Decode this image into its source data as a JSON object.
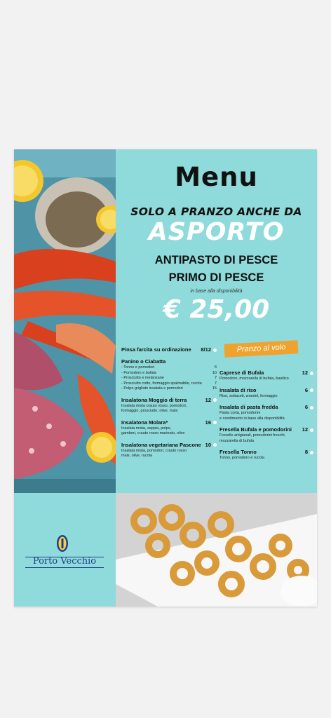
{
  "header": {
    "title": "Menu",
    "tagline": "SOLO A PRANZO ANCHE DA",
    "highlight": "ASPORTO"
  },
  "offer": {
    "line1": "ANTIPASTO DI PESCE",
    "line2": "PRIMO DI PESCE",
    "note": "in base alla disponibilità",
    "price": "€ 25,00"
  },
  "banner": "Pranzo al volo",
  "left_column": [
    {
      "name": "Pinsa farcita su ordinazione",
      "price": "8/12",
      "desc": []
    },
    {
      "name": "Panino o Ciabatta",
      "price": "",
      "desc": [
        {
          "text": "- Tonno e pomodori",
          "price": "6"
        },
        {
          "text": "- Pomodoro e bufala",
          "price": "10"
        },
        {
          "text": "- Prosciutto e melanzane",
          "price": "7"
        },
        {
          "text": "- Prosciutto cotto, formaggio spalmabile, rucola",
          "price": "7"
        },
        {
          "text": "- Polpo grigliato insalata e pomodori",
          "price": "15"
        }
      ]
    },
    {
      "name": "Insalatona Moggio di terra",
      "price": "12",
      "desc": [
        {
          "text": "Insalata mista crauto rosso, pomodori,",
          "price": ""
        },
        {
          "text": "formaggio, prosciutto, olive, mais",
          "price": ""
        }
      ]
    },
    {
      "name": "Insalatona Molara*",
      "price": "16",
      "desc": [
        {
          "text": "Insalata mista, seppia, polpo,",
          "price": ""
        },
        {
          "text": "gamberi, crauto rosso marinato, olive",
          "price": ""
        }
      ]
    },
    {
      "name": "Insalatona vegetariana Pascone",
      "price": "10",
      "desc": [
        {
          "text": "Insalata mista, pomodori, crauto rosso",
          "price": ""
        },
        {
          "text": "mais, olive, rucola",
          "price": ""
        }
      ]
    }
  ],
  "right_column": [
    {
      "name": "Caprese di Bufala",
      "price": "12",
      "desc": [
        {
          "text": "Pomodoro, mozzarella di bufala, basilico",
          "price": ""
        }
      ]
    },
    {
      "name": "Insalata di riso",
      "price": "6",
      "desc": [
        {
          "text": "Riso, sottaceti, wurstel, formaggio",
          "price": ""
        }
      ]
    },
    {
      "name": "Insalata di pasta fredda",
      "price": "6",
      "desc": [
        {
          "text": "Pasta corta, pomodorini",
          "price": ""
        },
        {
          "text": "e condimento in base alla disponibilità",
          "price": ""
        }
      ]
    },
    {
      "name": "Fresella Bufala e pomodorini",
      "price": "12",
      "desc": [
        {
          "text": "Freselle artigianali, pomodorini freschi,",
          "price": ""
        },
        {
          "text": "mozzarella di bufala",
          "price": ""
        }
      ]
    },
    {
      "name": "Fresella Tonno",
      "price": "8",
      "desc": [
        {
          "text": "Tonno, pomodoro e rucola",
          "price": ""
        }
      ]
    }
  ],
  "logo": {
    "text": "Porto Vecchio"
  },
  "colors": {
    "background": "#8fdada",
    "accent": "#f0a22e",
    "logo": "#1f3f8a"
  }
}
